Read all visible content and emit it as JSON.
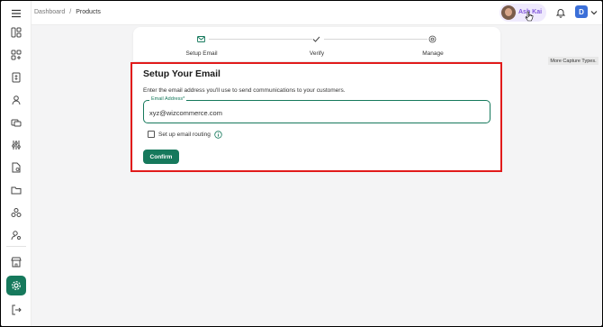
{
  "header": {
    "breadcrumb": [
      "Dashboard",
      "/",
      "Products"
    ],
    "user_name": "Ash Kai",
    "user_initial": "D"
  },
  "stepper": {
    "steps": [
      {
        "label": "Setup Email",
        "icon": "mail-icon"
      },
      {
        "label": "Verify",
        "icon": "check-icon"
      },
      {
        "label": "Manage",
        "icon": "gear-icon"
      }
    ]
  },
  "main": {
    "title": "Setup Your Email",
    "description": "Enter the email address you'll use to send communications to your customers.",
    "email_label": "Email Address*",
    "email_value": "xyz@wizcommerce.com",
    "routing_label": "Set up email routing",
    "routing_checked": false,
    "confirm_label": "Confirm"
  },
  "tooltip": {
    "text": "More Capture Types."
  },
  "colors": {
    "accent": "#16795c",
    "highlight": "#e11b1b",
    "user_pill": "#efeafd",
    "badge": "#3b6fd8"
  }
}
